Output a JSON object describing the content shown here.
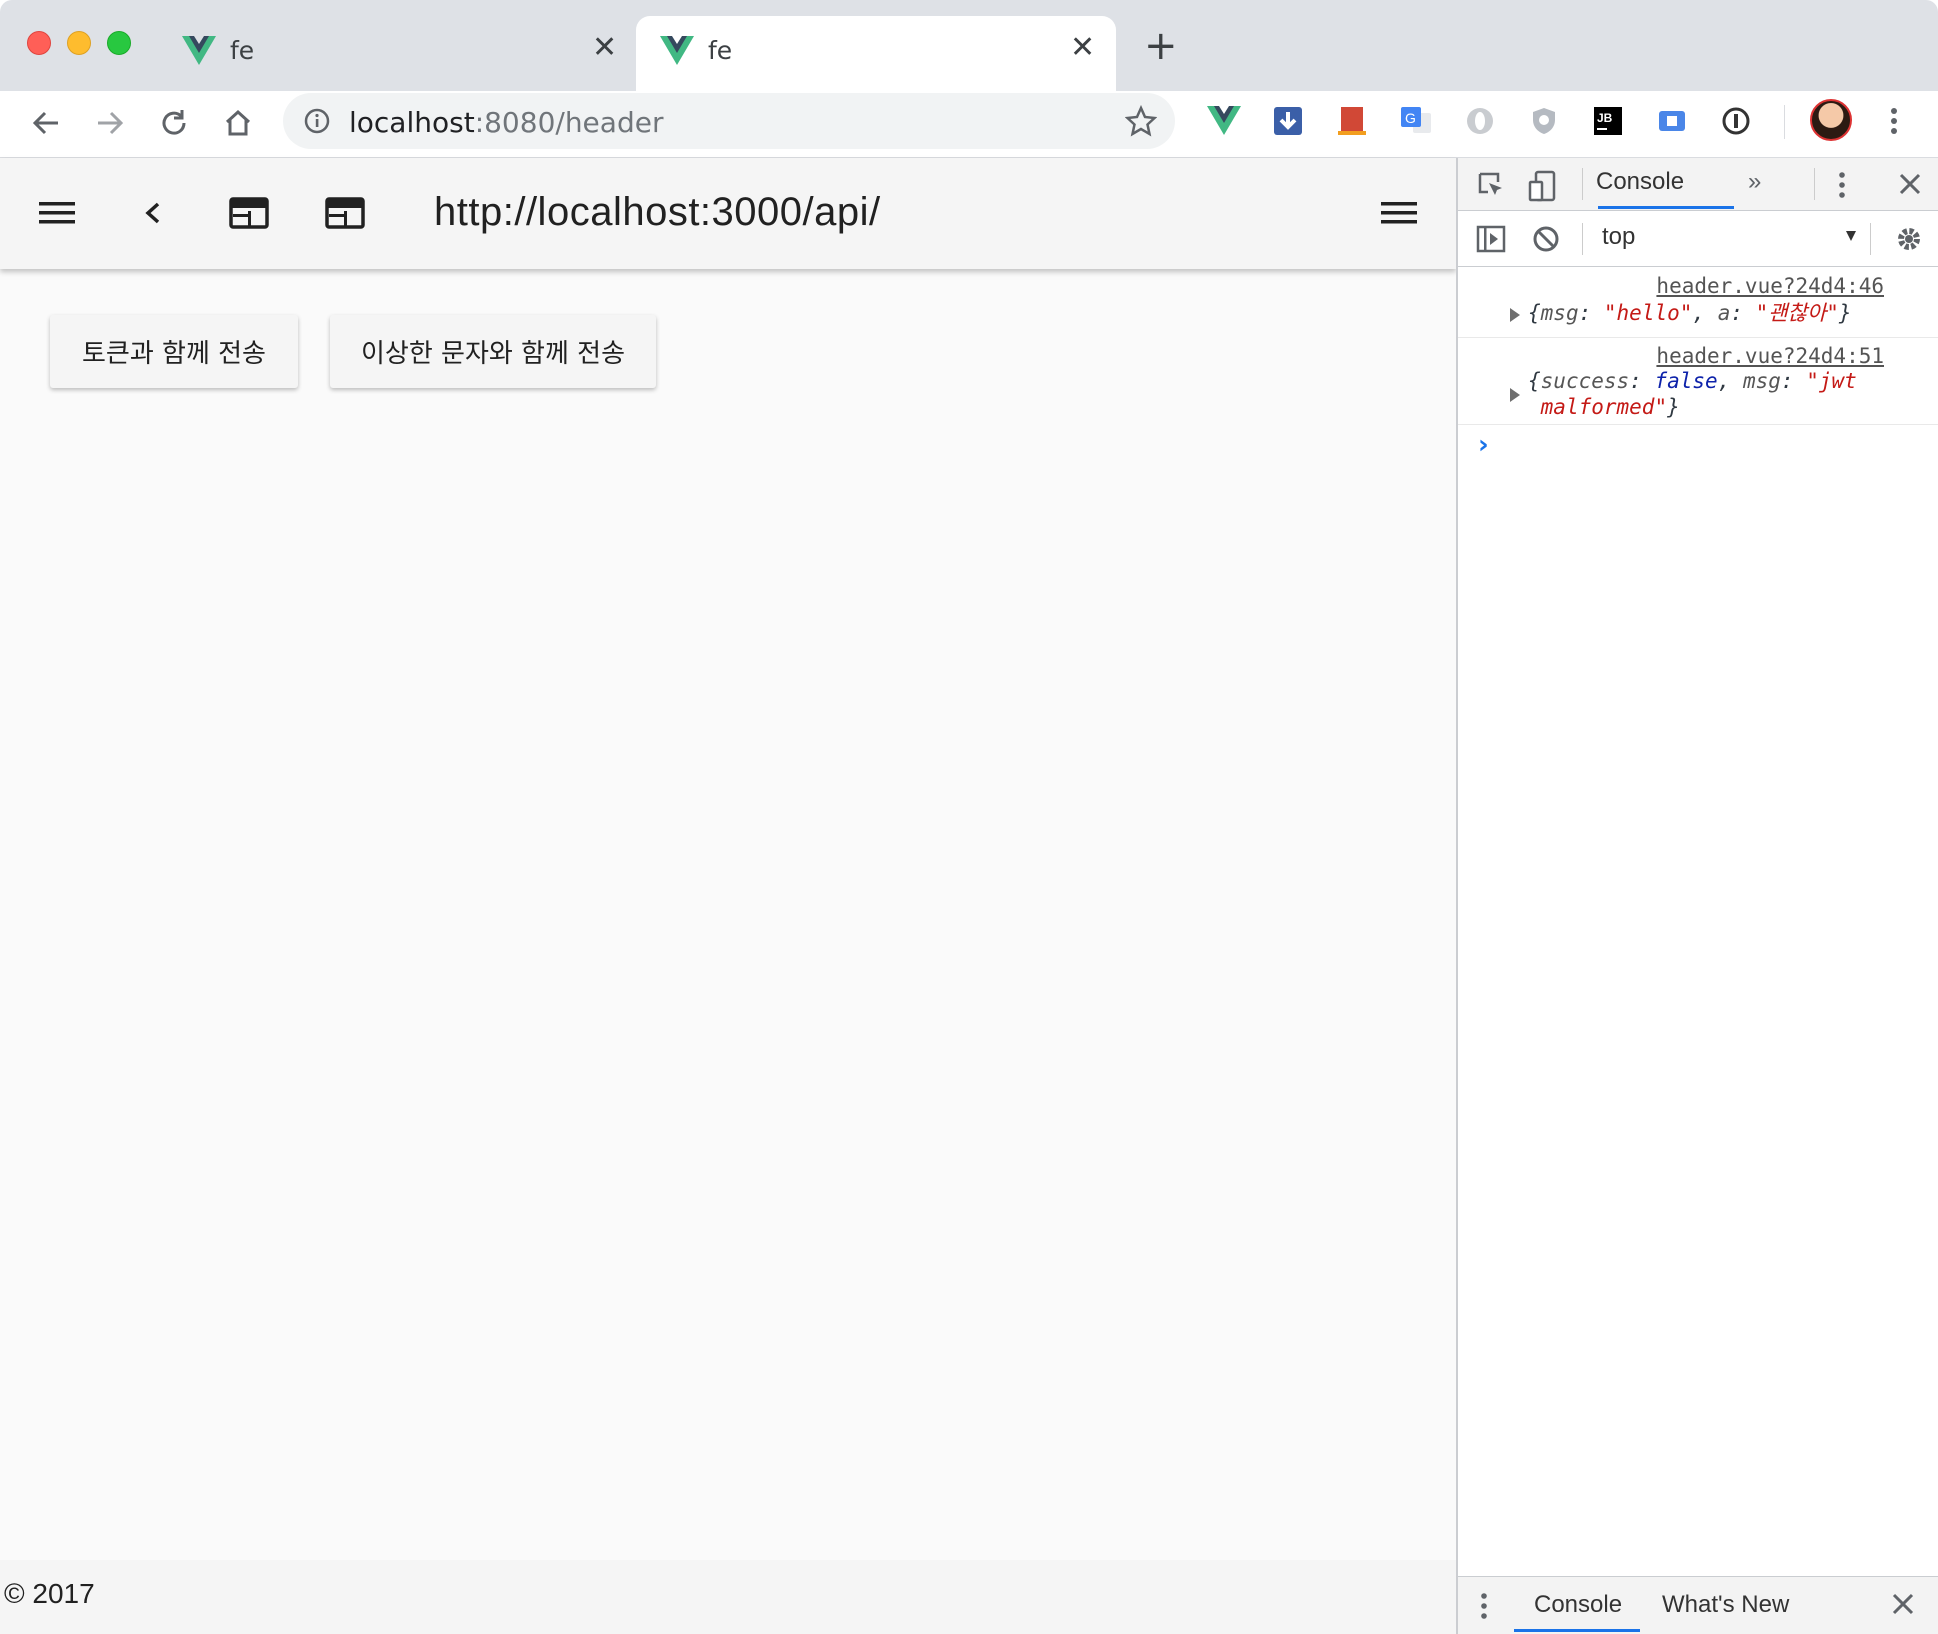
{
  "browser": {
    "tabs": [
      {
        "title": "fe",
        "active": false
      },
      {
        "title": "fe",
        "active": true
      }
    ],
    "url_host": "localhost",
    "url_path": ":8080/header"
  },
  "app": {
    "title": "http://localhost:3000/api/",
    "buttons": {
      "with_token": "토큰과 함께 전송",
      "with_weird_chars": "이상한 문자와 함께 전송"
    },
    "footer": "© 2017"
  },
  "devtools": {
    "active_tab": "Console",
    "context": "top",
    "logs": [
      {
        "source": "header.vue?24d4:46",
        "open": "{",
        "k1": "msg",
        "v1": "\"hello\"",
        "k2": "a",
        "v2": "\"괜찮아\"",
        "close": "}"
      },
      {
        "source": "header.vue?24d4:51",
        "open": "{",
        "k1": "success",
        "v1": "false",
        "k2": "msg",
        "v2a": "\"jwt",
        "v2b": "malformed\"",
        "close": "}"
      }
    ],
    "drawer_tabs": [
      "Console",
      "What's New"
    ]
  },
  "colors": {
    "accent": "#1a73e8",
    "vue_green": "#41b883",
    "vue_dark": "#35495e"
  }
}
